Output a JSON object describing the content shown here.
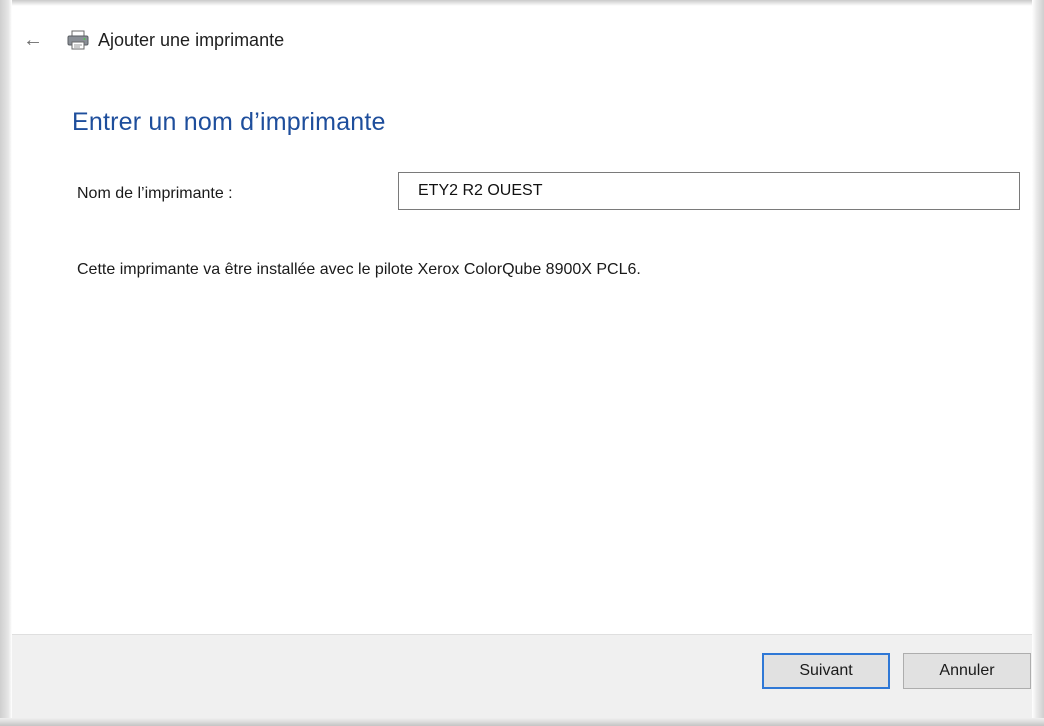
{
  "window": {
    "title": "Ajouter une imprimante",
    "back_glyph": "←",
    "back_icon": "back-arrow-icon",
    "title_icon": "printer-icon"
  },
  "page": {
    "heading": "Entrer un nom d’imprimante"
  },
  "form": {
    "name_label": "Nom de l’imprimante :",
    "name_value": "ETY2 R2 OUEST"
  },
  "info": {
    "driver_text": "Cette imprimante va être installée avec le pilote Xerox ColorQube 8900X PCL6."
  },
  "buttons": {
    "next_label": "Suivant",
    "cancel_label": "Annuler"
  },
  "colors": {
    "heading": "#1e4e9c",
    "focus_border": "#2f78d6",
    "footer_bg": "#f0f0f0"
  }
}
